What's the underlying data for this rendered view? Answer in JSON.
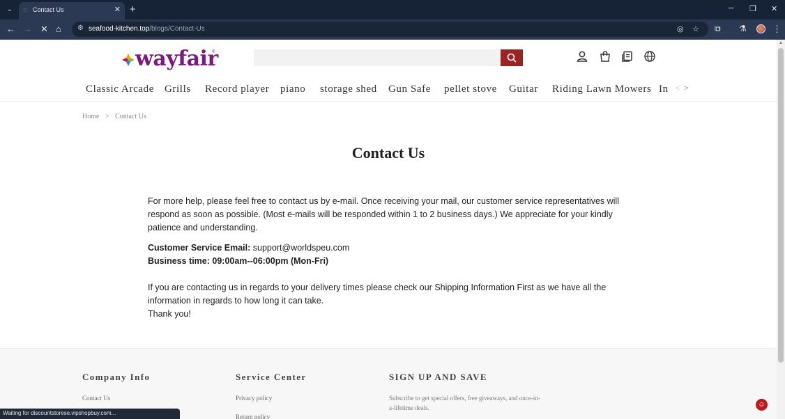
{
  "browser": {
    "tab_title": "Contact Us",
    "url_host": "seafood-kitchen.top",
    "url_path": "/blogs/Contact-Us",
    "status_text": "Waiting for discountstorese.vipshopbuy.com..."
  },
  "site": {
    "logo_text": "wayfair",
    "logo_reg": "®",
    "search_placeholder": "",
    "brand_color": "#7f187f",
    "search_button_color": "#9b2423"
  },
  "categories": [
    "Classic Arcade",
    "Grills",
    "Record player",
    "piano",
    "storage shed",
    "Gun Safe",
    "pellet stove",
    "Guitar",
    "Riding Lawn Mowers",
    "In"
  ],
  "breadcrumb": {
    "home": "Home",
    "separator": ">",
    "current": "Contact Us"
  },
  "page": {
    "title": "Contact Us",
    "intro": "For more help, please feel free to contact us by e-mail. Once receiving your mail, our customer service representatives will respond as soon as possible. (Most e-mails will be responded within 1 to 2 business days.) We appreciate for your kindly patience and understanding.",
    "email_label": "Customer Service Email:",
    "email_value": "support@worldspeu.com",
    "business_time": "Business time: 09:00am--06:00pm (Mon-Fri)",
    "shipping_note": "If you are contacting us in regards to your delivery times please check our Shipping Information First as we have all the information in regards to how long it can take.",
    "thanks": "Thank you!"
  },
  "footer": {
    "company_title": "Company Info",
    "company_links": [
      "Contact Us"
    ],
    "service_title": "Service Center",
    "service_links": [
      "Privacy policy",
      "Return policy"
    ],
    "signup_title": "SIGN UP AND SAVE",
    "signup_text": "Subscribe to get special offers, free giveaways, and once-in-a-lifetime deals."
  }
}
